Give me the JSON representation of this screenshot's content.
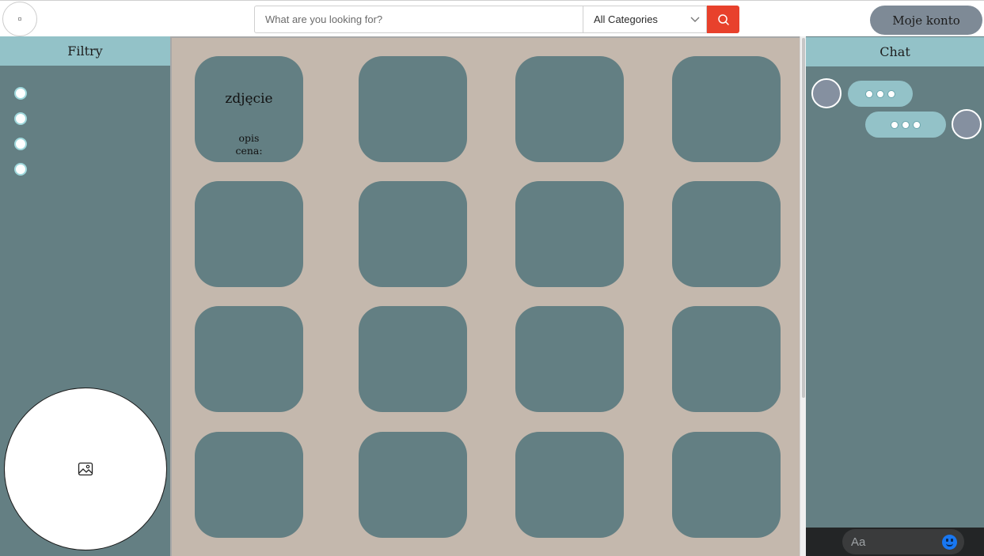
{
  "header": {
    "search_placeholder": "What are you looking for?",
    "category_selected": "All Categories",
    "account_label": "Moje konto",
    "search_icon": "search-icon",
    "dropdown_icon": "chevron-down-icon",
    "accent_color": "#e8412c"
  },
  "sidebar": {
    "title": "Filtry",
    "filter_options": [
      "",
      "",
      "",
      ""
    ],
    "photo_icon": "image-icon"
  },
  "grid": {
    "first_tile": {
      "title": "zdjęcie",
      "desc_line1": "opis",
      "desc_line2": "cena:"
    },
    "tile_color": "#637f83",
    "background_color": "#c4b8ad"
  },
  "chat": {
    "title": "Chat",
    "input_placeholder": "Aa",
    "emoji_icon": "smiley-icon",
    "messages": [
      {
        "side": "left",
        "content": "typing-dots"
      },
      {
        "side": "right",
        "content": "typing-dots"
      }
    ]
  }
}
